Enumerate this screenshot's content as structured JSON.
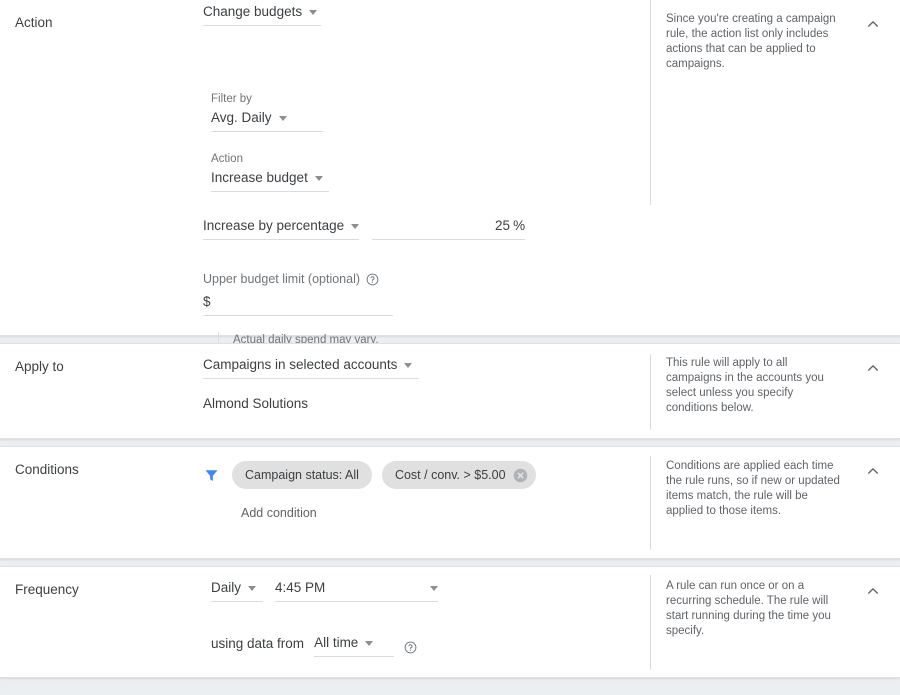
{
  "sections": {
    "action": {
      "label": "Action",
      "change_budgets": "Change budgets",
      "filter_by_label": "Filter by",
      "filter_by_value": "Avg. Daily",
      "action_label": "Action",
      "action_value": "Increase budget",
      "amount_type": "Increase by percentage",
      "amount_value": "25",
      "amount_unit": "%",
      "upper_limit_label": "Upper budget limit (optional)",
      "upper_limit_value": "$",
      "note": "Actual daily spend may vary.",
      "help": "Since you're creating a campaign rule, the action list only includes actions that can be applied to campaigns."
    },
    "apply_to": {
      "label": "Apply to",
      "scope": "Campaigns in selected accounts",
      "account": "Almond Solutions",
      "help": "This rule will apply to all campaigns in the accounts you select unless you specify conditions below."
    },
    "conditions": {
      "label": "Conditions",
      "chips": [
        {
          "text": "Campaign status: All",
          "removable": false
        },
        {
          "text": "Cost / conv. > $5.00",
          "removable": true
        }
      ],
      "add_condition": "Add condition",
      "help": "Conditions are applied each time the rule runs, so if new or updated items match, the rule will be applied to those items."
    },
    "frequency": {
      "label": "Frequency",
      "interval": "Daily",
      "time": "4:45 PM",
      "using_data_from_label": "using data from",
      "using_data_from_value": "All time",
      "help": "A rule can run once or on a recurring schedule. The rule will start running during the time you specify."
    }
  },
  "icons": {
    "caret": "chevron-down-icon",
    "collapse": "chevron-up-icon",
    "help": "help-circle-icon",
    "filter": "filter-funnel-icon",
    "remove": "remove-circle-icon"
  },
  "colors": {
    "accent": "#4285f4",
    "text": "#3c4043",
    "muted": "#70757a",
    "line": "#dadce0",
    "chip": "#e0e0e0",
    "page_bg": "#eceff1"
  }
}
